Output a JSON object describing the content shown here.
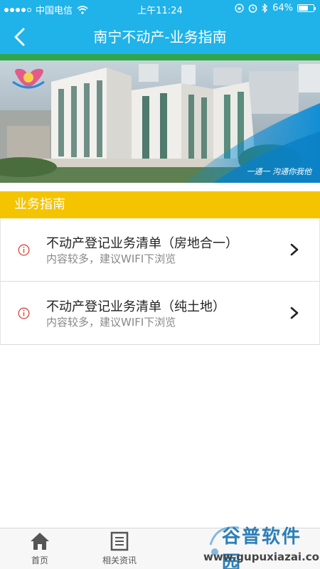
{
  "status_bar": {
    "carrier": "中国电信",
    "time": "上午11:24",
    "battery": "64%",
    "battery_level": 0.64
  },
  "header": {
    "title": "南宁不动产-业务指南"
  },
  "banner": {
    "caption": "一通一 沟通你我他"
  },
  "section": {
    "title": "业务指南"
  },
  "list": {
    "items": [
      {
        "title": "不动产登记业务清单（房地合一）",
        "subtitle": "内容较多，建议WIFI下浏览"
      },
      {
        "title": "不动产登记业务清单（纯土地）",
        "subtitle": "内容较多，建议WIFI下浏览"
      }
    ]
  },
  "tabbar": {
    "tabs": [
      {
        "label": "首页"
      },
      {
        "label": "相关资讯"
      }
    ]
  },
  "watermark": {
    "name": "谷普软件园",
    "url": "www.gupuxiazai.com"
  },
  "colors": {
    "header": "#1fb3e9",
    "section": "#f4c400",
    "strip": "#2fa64a"
  }
}
